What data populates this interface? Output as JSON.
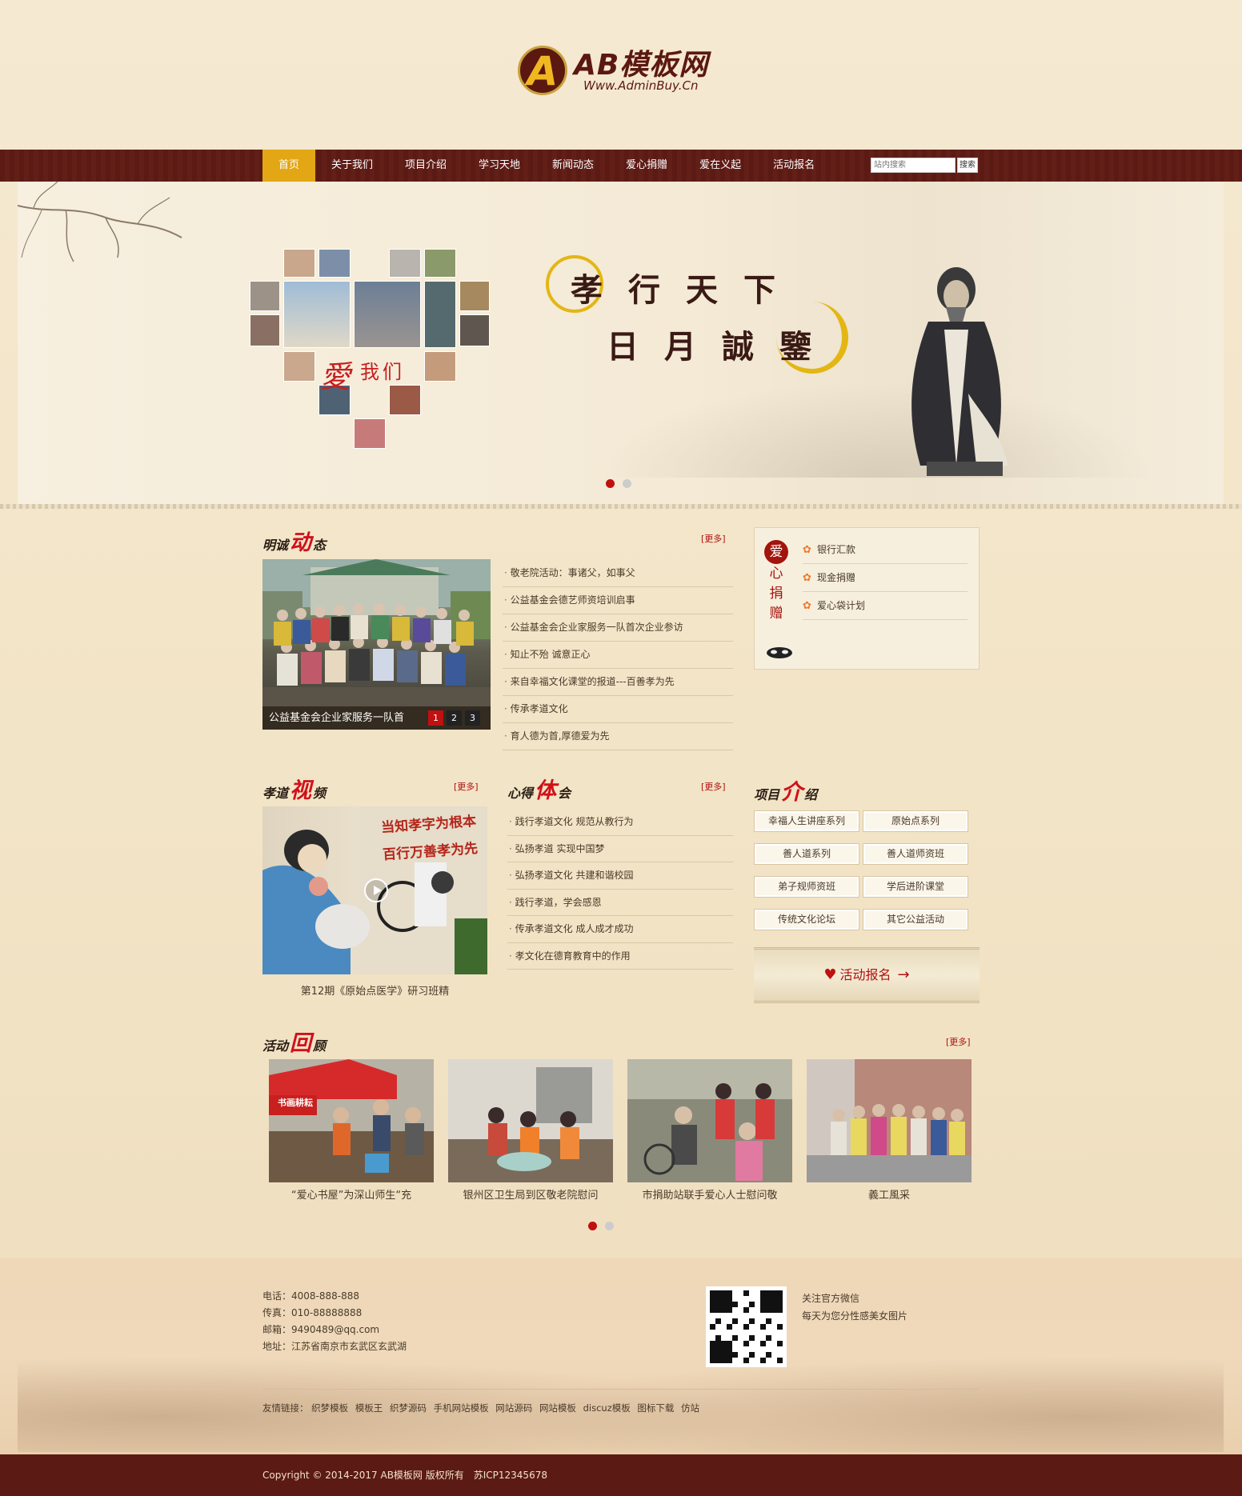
{
  "logo": {
    "title": "AB模板网",
    "url": "Www.AdminBuy.Cn",
    "badge": "A"
  },
  "nav": {
    "items": [
      "首页",
      "关于我们",
      "项目介绍",
      "学习天地",
      "新闻动态",
      "爱心捐赠",
      "爱在义起",
      "活动报名"
    ],
    "active_index": 0,
    "search_placeholder": "站内搜索",
    "search_button": "搜索"
  },
  "banner": {
    "line1": "孝行天下",
    "line2": "日月誠鑒",
    "love_text": "愛",
    "love_text_small": "我们",
    "slides": 2,
    "active_slide": 0
  },
  "news": {
    "title_parts": [
      "明诚",
      "动",
      "态"
    ],
    "more": "[更多]",
    "caption": "公益基金会企业家服务一队首",
    "pager": [
      "1",
      "2",
      "3"
    ],
    "items": [
      "敬老院活动：事诸父，如事父",
      "公益基金会德艺师资培训启事",
      "公益基金会企业家服务一队首次企业参访",
      "知止不殆 诚意正心",
      "来自幸福文化课堂的报道---百善孝为先",
      "传承孝道文化",
      "育人德为首,厚德爱为先"
    ]
  },
  "donate": {
    "vertical": [
      "爱",
      "心",
      "捐",
      "赠"
    ],
    "items": [
      "银行汇款",
      "现金捐赠",
      "爱心袋计划"
    ]
  },
  "video": {
    "title_parts": [
      "孝道",
      "视",
      "频"
    ],
    "more": "[更多]",
    "caption": "第12期《原始点医学》研习班精",
    "wall_text_1": "当知孝字为根本",
    "wall_text_2": "百行万善孝为先"
  },
  "experience": {
    "title_parts": [
      "心得",
      "体",
      "会"
    ],
    "more": "[更多]",
    "items": [
      "践行孝道文化 规范从教行为",
      "弘扬孝道 实现中国梦",
      "弘扬孝道文化 共建和谐校园",
      "践行孝道，学会感恩",
      "传承孝道文化 成人成才成功",
      "孝文化在德育教育中的作用"
    ]
  },
  "projects": {
    "title_parts": [
      "项目",
      "介",
      "绍"
    ],
    "items": [
      "幸福人生讲座系列",
      "原始点系列",
      "善人道系列",
      "善人道师资班",
      "弟子规师资班",
      "学后进阶课堂",
      "传统文化论坛",
      "其它公益活动"
    ],
    "signup": "活动报名"
  },
  "activities": {
    "title_parts": [
      "活动",
      "回",
      "顾"
    ],
    "more": "[更多]",
    "items": [
      {
        "caption": "“爱心书屋”为深山师生“充",
        "banner_text": "书画耕耘"
      },
      {
        "caption": "银州区卫生局到区敬老院慰问"
      },
      {
        "caption": "市捐助站联手爱心人士慰问敬"
      },
      {
        "caption": "義工風采"
      }
    ],
    "slides": 2,
    "active_slide": 0
  },
  "footer": {
    "phone": "电话：4008-888-888",
    "fax": "传真：010-88888888",
    "email": "邮箱：9490489@qq.com",
    "address": "地址：江苏省南京市玄武区玄武湖",
    "wechat_title": "关注官方微信",
    "wechat_sub": "每天为您分性感美女图片",
    "friend_label": "友情链接：",
    "friend_links": [
      "织梦模板",
      "模板王",
      "织梦源码",
      "手机网站模板",
      "网站源码",
      "网站模板",
      "discuz模板",
      "图标下载",
      "仿站"
    ],
    "copyright": "Copyright © 2014-2017 AB模板网 版权所有　苏ICP12345678"
  },
  "colors": {
    "nav_bg": "#5c1a14",
    "nav_active": "#e3a614",
    "accent_red": "#c01010",
    "text": "#4a3a2a"
  }
}
